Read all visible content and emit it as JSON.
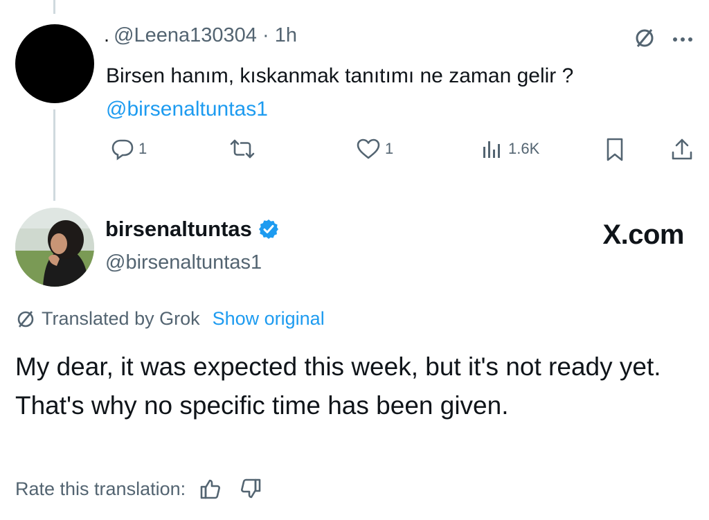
{
  "reply": {
    "dot": ".",
    "handle": "@Leena130304",
    "separator": "·",
    "time": "1h",
    "text": "Birsen hanım, kıskanmak tanıtımı ne zaman gelir ? ",
    "mention": "@birsenaltuntas1",
    "icons": [
      "translate-slash-icon",
      "more-dots-icon"
    ],
    "actions": {
      "reply_count": "1",
      "retweet_count": "",
      "like_count": "1",
      "views": "1.6K"
    }
  },
  "post": {
    "display_name": "birsenaltuntas",
    "verified": true,
    "handle": "@birsenaltuntas1",
    "watermark": "X.com",
    "translated_by": "Translated by Grok",
    "show_original": "Show original",
    "text": "My dear, it was expected this week, but it's not ready yet. That's why no specific time has been given.",
    "rate_label": "Rate this translation:"
  },
  "colors": {
    "accent": "#1d9bf0",
    "muted": "#536471",
    "text": "#0f1419",
    "thread_line": "#cfd9de"
  }
}
